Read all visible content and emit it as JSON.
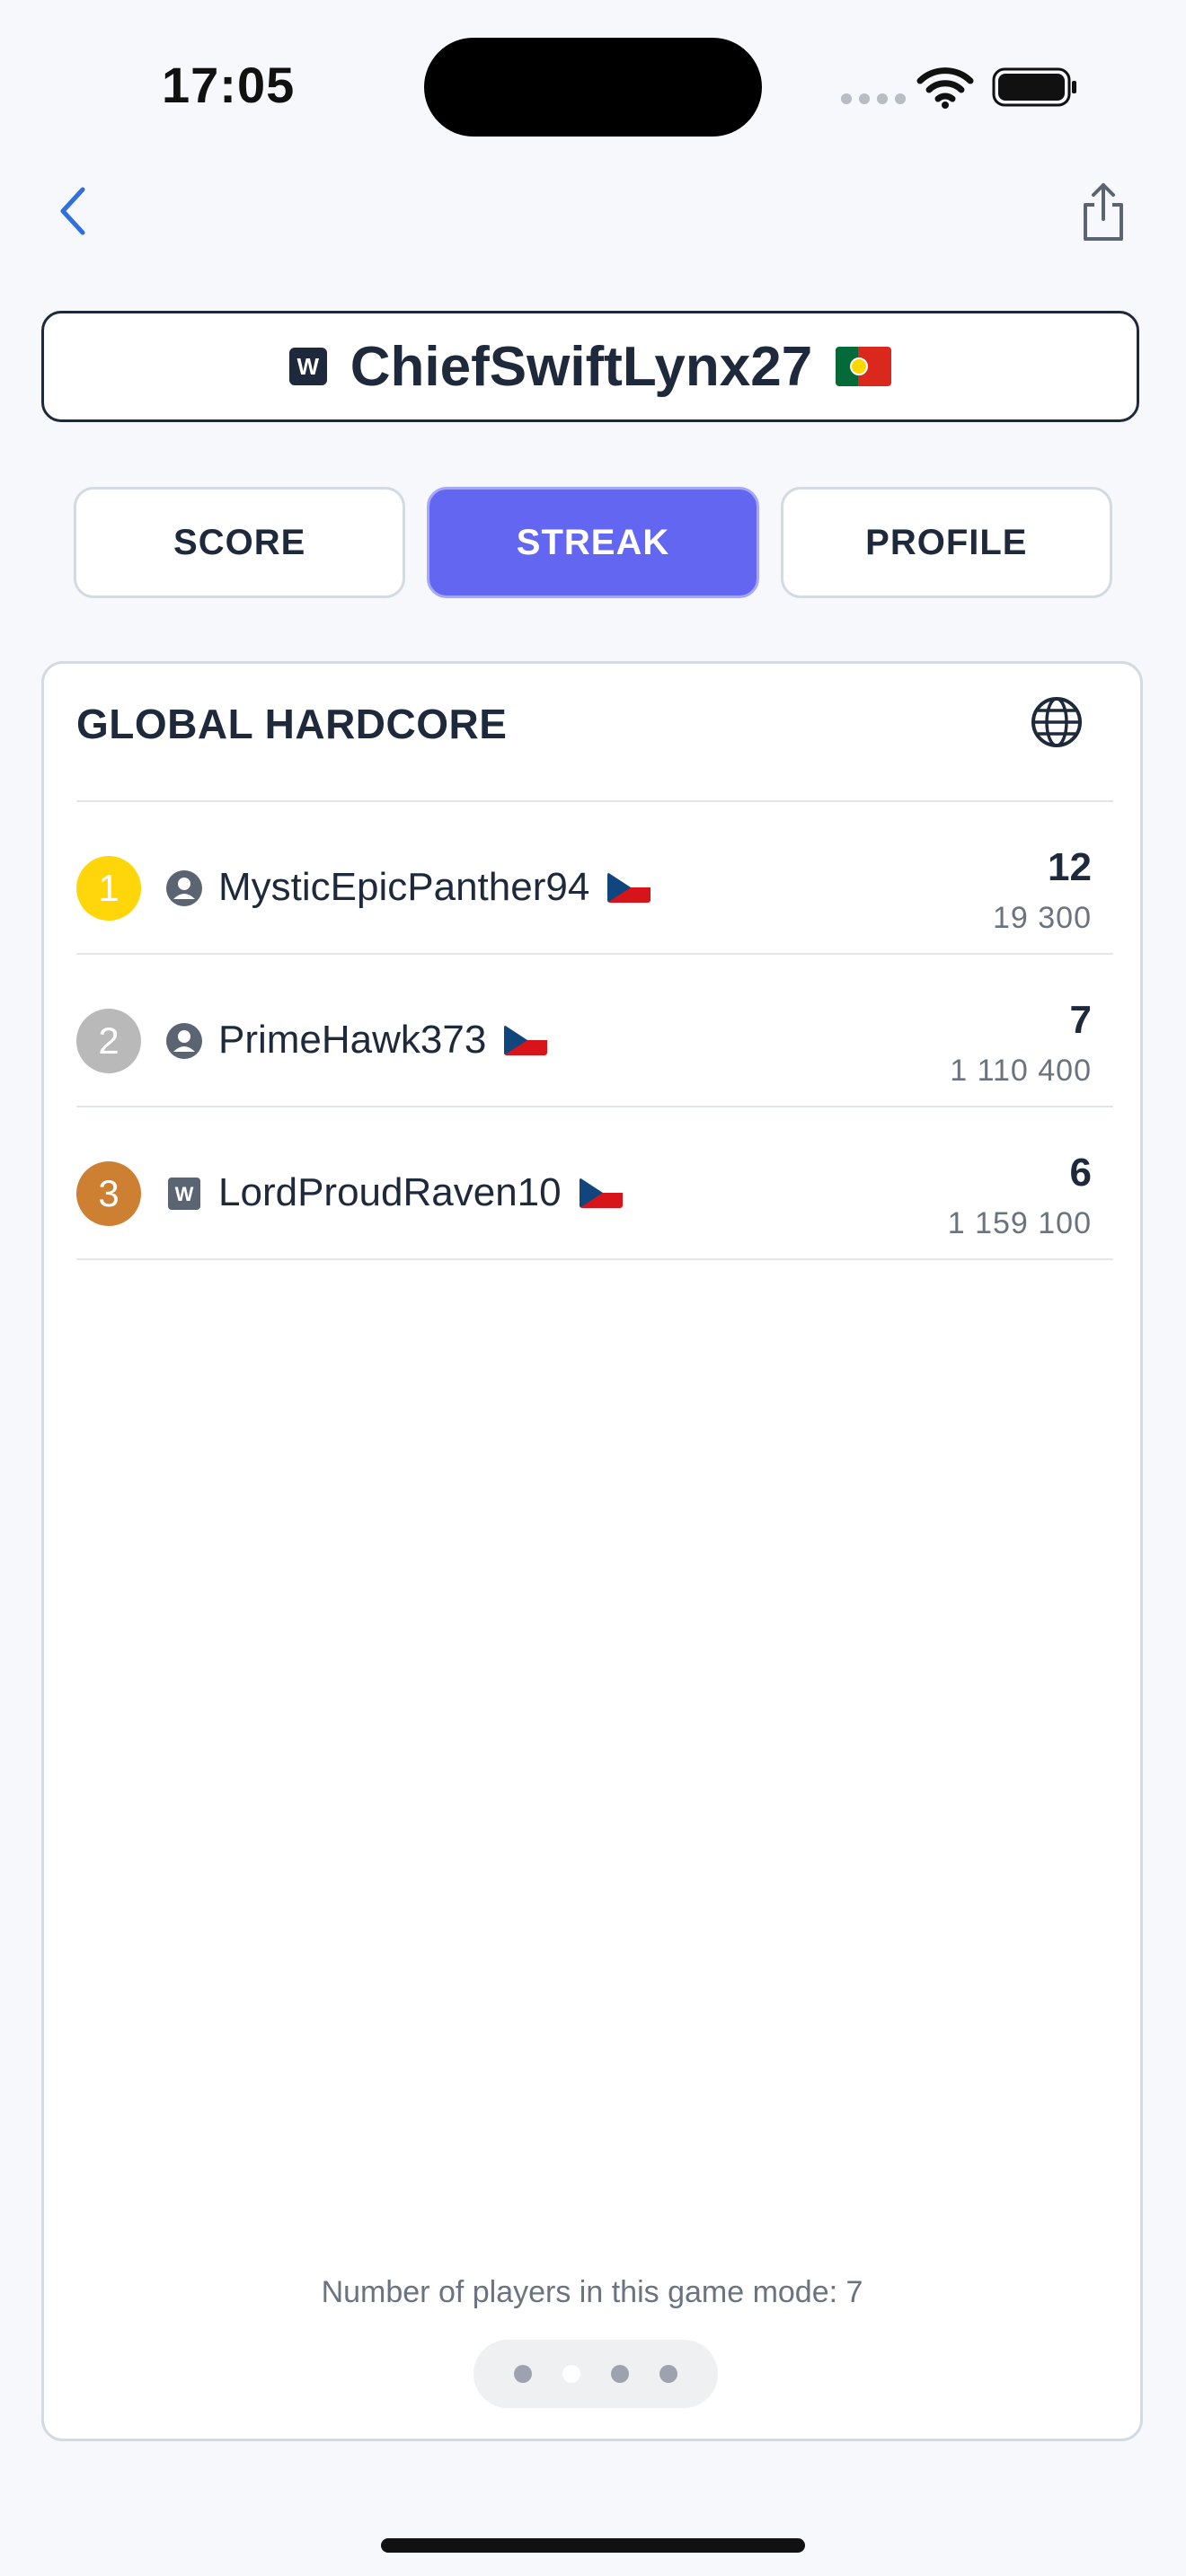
{
  "status_bar": {
    "time": "17:05"
  },
  "header": {
    "player_name": "ChiefSwiftLynx27",
    "player_badge": "W"
  },
  "tabs": [
    {
      "label": "SCORE",
      "active": false
    },
    {
      "label": "STREAK",
      "active": true
    },
    {
      "label": "PROFILE",
      "active": false
    }
  ],
  "leaderboard": {
    "title": "GLOBAL HARDCORE",
    "rows": [
      {
        "rank": "1",
        "rank_color": "#FFD60A",
        "user_type": "person",
        "name": "MysticEpicPanther94",
        "country": "CZ",
        "streak": "12",
        "score": "19 300"
      },
      {
        "rank": "2",
        "rank_color": "#B9B9B9",
        "user_type": "person",
        "name": "PrimeHawk373",
        "country": "CZ",
        "streak": "7",
        "score": "1 110 400"
      },
      {
        "rank": "3",
        "rank_color": "#CD7F32",
        "user_type": "W",
        "name": "LordProudRaven10",
        "country": "CZ",
        "streak": "6",
        "score": "1 159 100"
      }
    ],
    "players_count_text": "Number of players in this game mode: 7",
    "pager": {
      "pages": 4,
      "current": 2
    }
  },
  "colors": {
    "accent": "#6366F1",
    "text": "#1E293B",
    "muted": "#6B7280",
    "border": "#D3DAE3"
  },
  "icons": {
    "back": "chevron-left-icon",
    "share": "share-icon",
    "globe": "globe-icon"
  }
}
